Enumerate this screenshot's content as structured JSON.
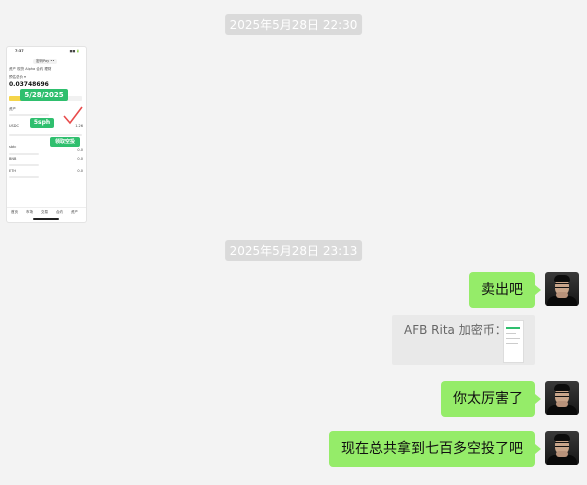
{
  "timestamps": [
    "2025年5月28日 22:30",
    "2025年5月28日 23:13"
  ],
  "screenshot": {
    "status_time": "7:37",
    "status_icons": "■■ 🔋",
    "top_tag": "密码Pay ••",
    "tabs": "资产  现货  Alpha  合约  理财",
    "balance_label": "预估总价 ▾",
    "balance_value": "0.03748696",
    "date_tag": "5/28/2025",
    "amount_tag": "5sph",
    "bottom_tag": "领取空投",
    "section_label": "资产",
    "row_labels": [
      "USDC",
      "sbtc",
      "BNB",
      "ETH"
    ],
    "row_values": [
      "1.26",
      "0.0",
      "0.0",
      "0.0"
    ],
    "nav_labels": [
      "首页",
      "市场",
      "交易",
      "合约",
      "资产"
    ]
  },
  "messages": [
    {
      "type": "text",
      "text": "卖出吧",
      "side": "right"
    },
    {
      "type": "card",
      "text": "AFB Rita 加密币：",
      "side": "right"
    },
    {
      "type": "text",
      "text": "你太厉害了",
      "side": "right"
    },
    {
      "type": "text",
      "text": "现在总共拿到七百多空投了吧",
      "side": "right"
    }
  ],
  "colors": {
    "background": "#f3f3f3",
    "bubble": "#95ec69",
    "timestamp_bg": "#dadada",
    "tag_green": "#2fbf6e",
    "card_bg": "#e9e9e9"
  }
}
